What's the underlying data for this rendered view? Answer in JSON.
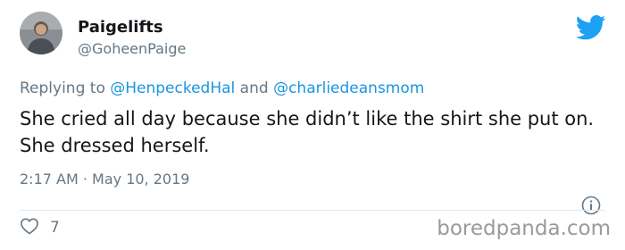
{
  "user": {
    "display_name": "Paigelifts",
    "handle": "@GoheenPaige"
  },
  "reply": {
    "prefix": "Replying to ",
    "mention1": "@HenpeckedHal",
    "connector": " and ",
    "mention2": "@charliedeansmom"
  },
  "tweet": {
    "text": "She cried all day because she didn’t like the shirt she put on. She dressed herself.",
    "time": "2:17 AM",
    "separator": " · ",
    "date": "May 10, 2019"
  },
  "actions": {
    "likes": "7"
  },
  "watermark": "boredpanda.com",
  "colors": {
    "accent": "#1b95e0",
    "twitter_blue": "#1da1f2",
    "muted": "#657786",
    "text": "#14171a"
  },
  "icons": [
    "twitter-bird-icon",
    "info-icon",
    "heart-icon"
  ]
}
